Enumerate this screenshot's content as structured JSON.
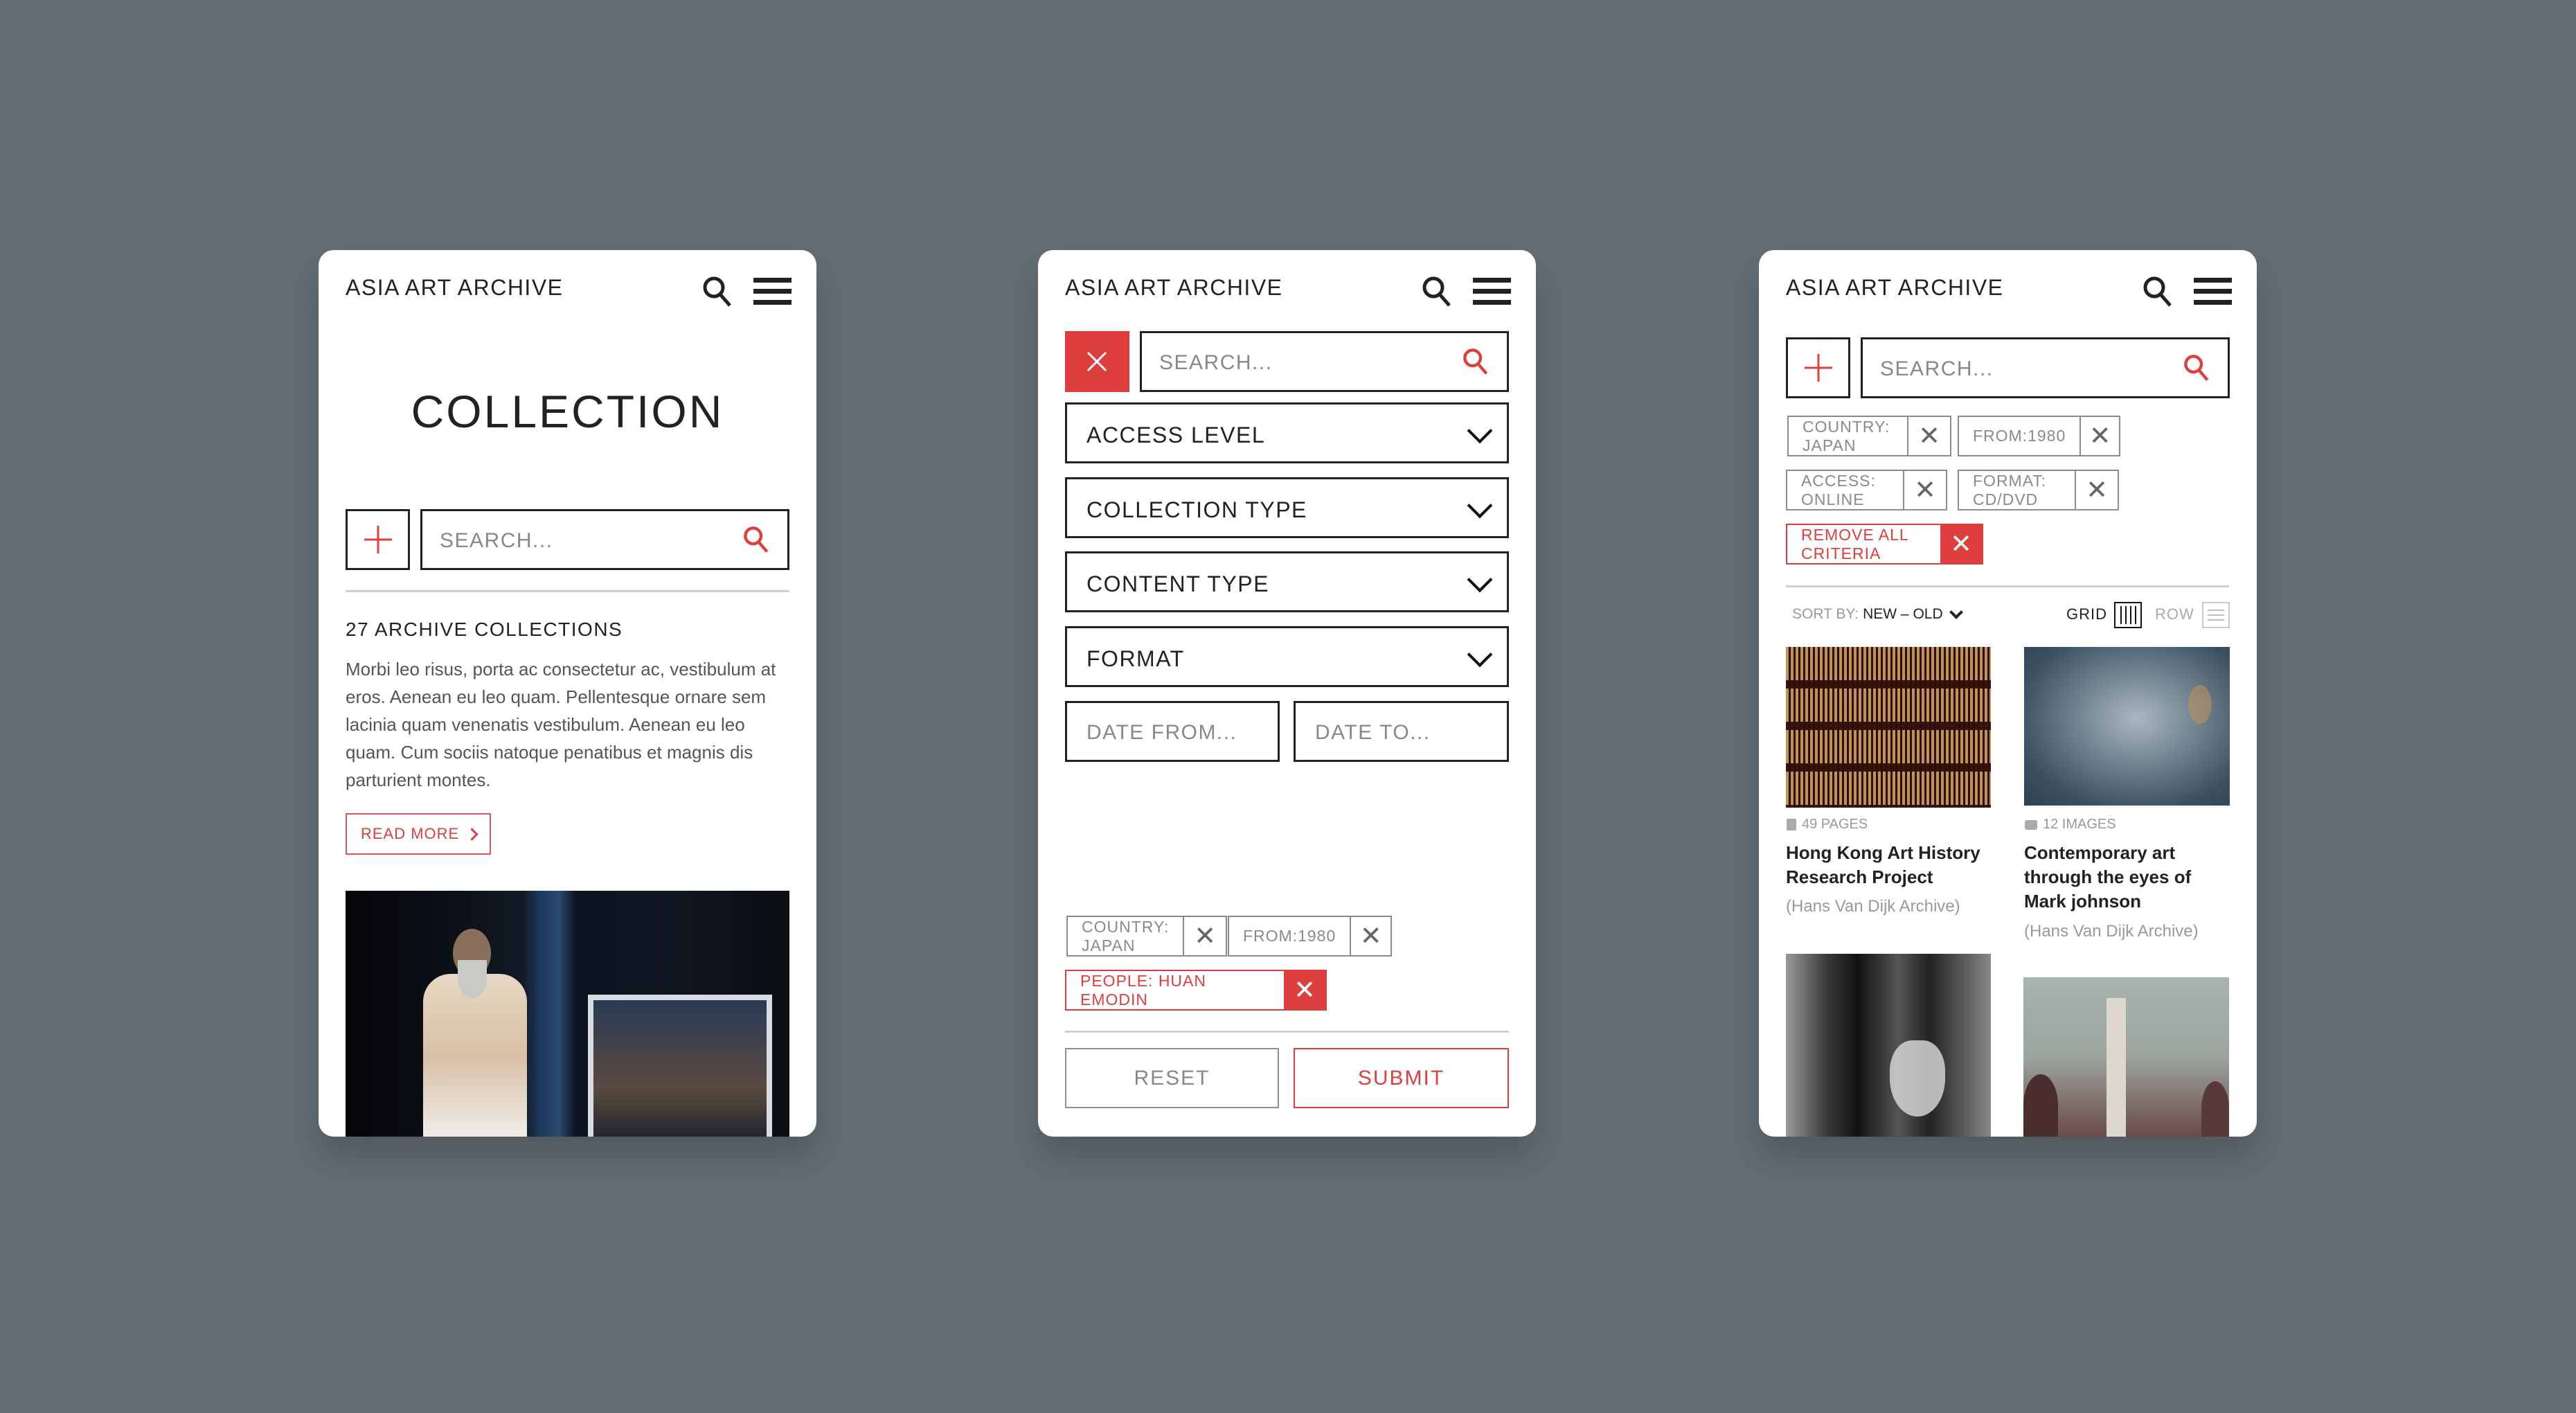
{
  "brand": "ASIA ART ARCHIVE",
  "colors": {
    "accent": "#dd3f3f",
    "background": "#636d74",
    "text": "#222222",
    "muted": "#8a8a8a"
  },
  "icons": {
    "search": "search-icon",
    "menu": "hamburger-menu-icon",
    "plus": "plus-icon",
    "close": "close-icon",
    "chevron": "chevron-down-icon",
    "pages": "pages-icon",
    "camera": "camera-icon",
    "grid": "grid-view-icon",
    "row": "row-view-icon"
  },
  "screen1": {
    "title": "COLLECTION",
    "search_placeholder": "SEARCH...",
    "count_heading": "27 ARCHIVE COLLECTIONS",
    "description": "Morbi leo risus, porta ac consectetur ac, vestibulum at eros. Aenean eu leo quam. Pellentesque ornare sem lacinia quam venenatis vestibulum. Aenean eu leo quam. Cum sociis natoque penatibus et magnis dis parturient montes.",
    "read_more": "READ MORE",
    "photo": "Bearded man in vest leaning in doorway"
  },
  "screen2": {
    "search_placeholder": "SEARCH...",
    "selects": [
      "ACCESS LEVEL",
      "COLLECTION TYPE",
      "CONTENT TYPE",
      "FORMAT"
    ],
    "date_from_placeholder": "DATE FROM...",
    "date_to_placeholder": "DATE TO...",
    "tags": [
      "COUNTRY: JAPAN",
      "FROM:1980"
    ],
    "active_tag": "PEOPLE: HUAN EMODIN",
    "reset": "RESET",
    "submit": "SUBMIT"
  },
  "screen3": {
    "search_placeholder": "SEARCH...",
    "tags": [
      "COUNTRY: JAPAN",
      "FROM:1980",
      "ACCESS: ONLINE",
      "FORMAT: CD/DVD"
    ],
    "remove_all": "REMOVE ALL CRITERIA",
    "sort_label": "SORT BY:",
    "sort_value": "NEW – OLD",
    "view_grid": "GRID",
    "view_row": "ROW",
    "items": [
      {
        "meta": "49 PAGES",
        "meta_icon": "pages-icon",
        "title": "Hong Kong Art History Research Project",
        "source": "(Hans Van Dijk Archive)",
        "photo": "Contact sheet of film negatives"
      },
      {
        "meta": "12 IMAGES",
        "meta_icon": "camera-icon",
        "title": "Contemporary art through the eyes of Mark johnson",
        "source": "(Hans Van Dijk Archive)",
        "photo": "Blue-toned face with closed eyes"
      },
      {
        "photo": "Elderly bearded man reading in study"
      },
      {
        "photo": "Misty outdoor installation with trees"
      }
    ]
  }
}
